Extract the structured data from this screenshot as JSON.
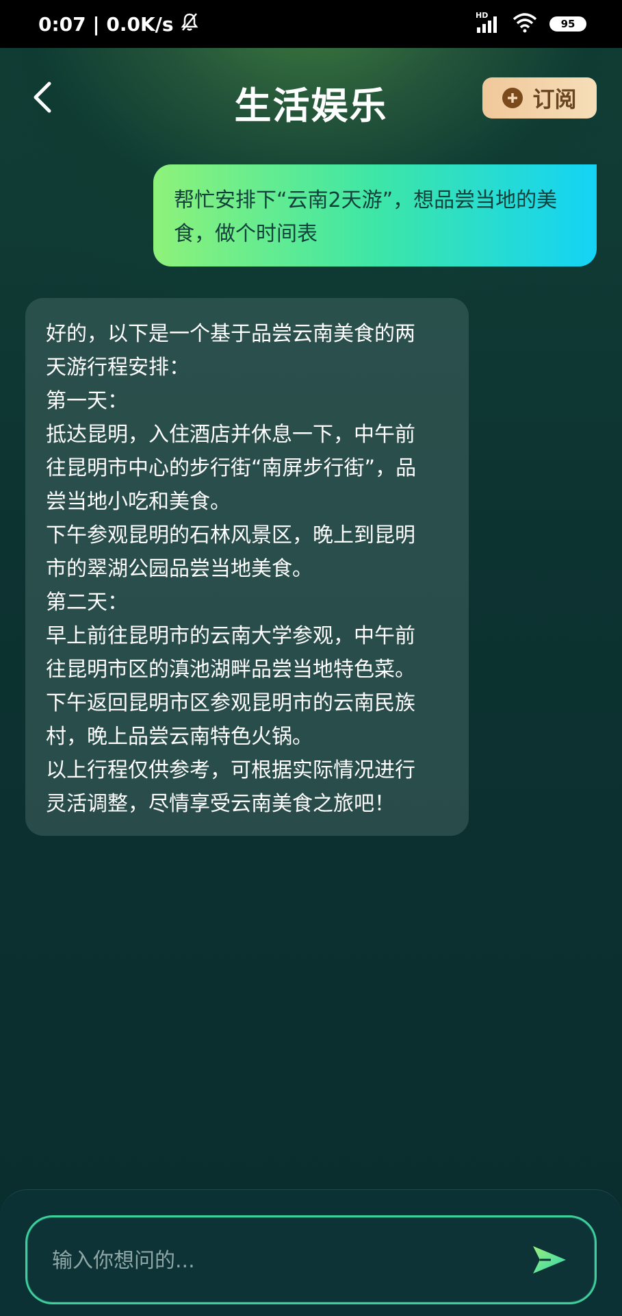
{
  "status_bar": {
    "time_speed": "0:07 | 0.0K/s",
    "network_label": "HD",
    "battery": "95"
  },
  "header": {
    "title": "生活娱乐",
    "subscribe_label": "订阅"
  },
  "messages": {
    "user": "帮忙安排下“云南2天游”，想品尝当地的美食，做个时间表",
    "bot_lines": [
      "好的，以下是一个基于品尝云南美食的两",
      "天游行程安排：",
      "第一天：",
      "抵达昆明，入住酒店并休息一下，中午前",
      "往昆明市中心的步行街“南屏步行街”，品",
      "尝当地小吃和美食。",
      "下午参观昆明的石林风景区，晚上到昆明",
      "市的翠湖公园品尝当地美食。",
      "第二天：",
      "早上前往昆明市的云南大学参观，中午前",
      "往昆明市区的滇池湖畔品尝当地特色菜。",
      "下午返回昆明市区参观昆明市的云南民族",
      "村，晚上品尝云南特色火锅。",
      "以上行程仅供参考，可根据实际情况进行",
      "灵活调整，尽情享受云南美食之旅吧！"
    ]
  },
  "input": {
    "placeholder": "输入你想问的..."
  },
  "colors": {
    "accent_green": "#3ecf9a",
    "subscribe_gold": "#f0c89a"
  }
}
